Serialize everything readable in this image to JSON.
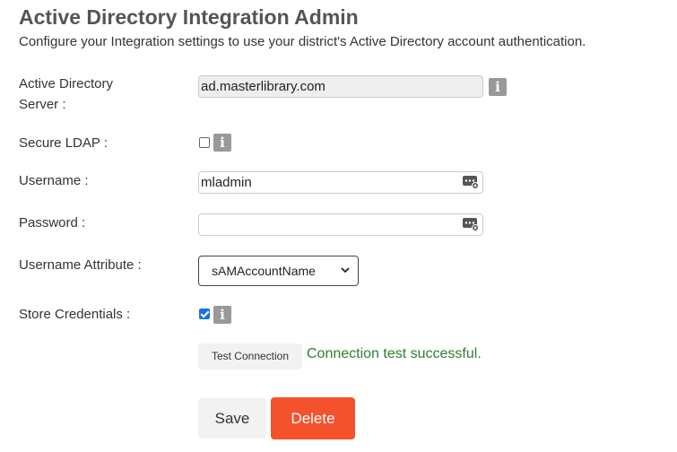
{
  "header": {
    "title": "Active Directory Integration Admin",
    "subtitle": "Configure your Integration settings to use your district's Active Directory account authentication."
  },
  "form": {
    "server": {
      "label_line1": "Active Directory",
      "label_line2": "Server :",
      "value": "ad.masterlibrary.com",
      "info_icon": "info-icon"
    },
    "secure_ldap": {
      "label": "Secure LDAP :",
      "checked": false,
      "info_icon": "info-icon"
    },
    "username": {
      "label": "Username :",
      "value": "mladmin",
      "icon": "password-manager-icon"
    },
    "password": {
      "label": "Password :",
      "value": "",
      "icon": "password-manager-icon"
    },
    "username_attribute": {
      "label": "Username Attribute :",
      "selected": "sAMAccountName"
    },
    "store_credentials": {
      "label": "Store Credentials :",
      "checked": true,
      "info_icon": "info-icon"
    },
    "info_glyph": "i"
  },
  "actions": {
    "test_connection": "Test Connection",
    "status": "Connection test successful.",
    "save": "Save",
    "delete": "Delete"
  },
  "colors": {
    "delete_button": "#f4522d",
    "success_text": "#2e7d32",
    "checkbox_checked": "#1a73e8",
    "info_icon": "#999999"
  }
}
